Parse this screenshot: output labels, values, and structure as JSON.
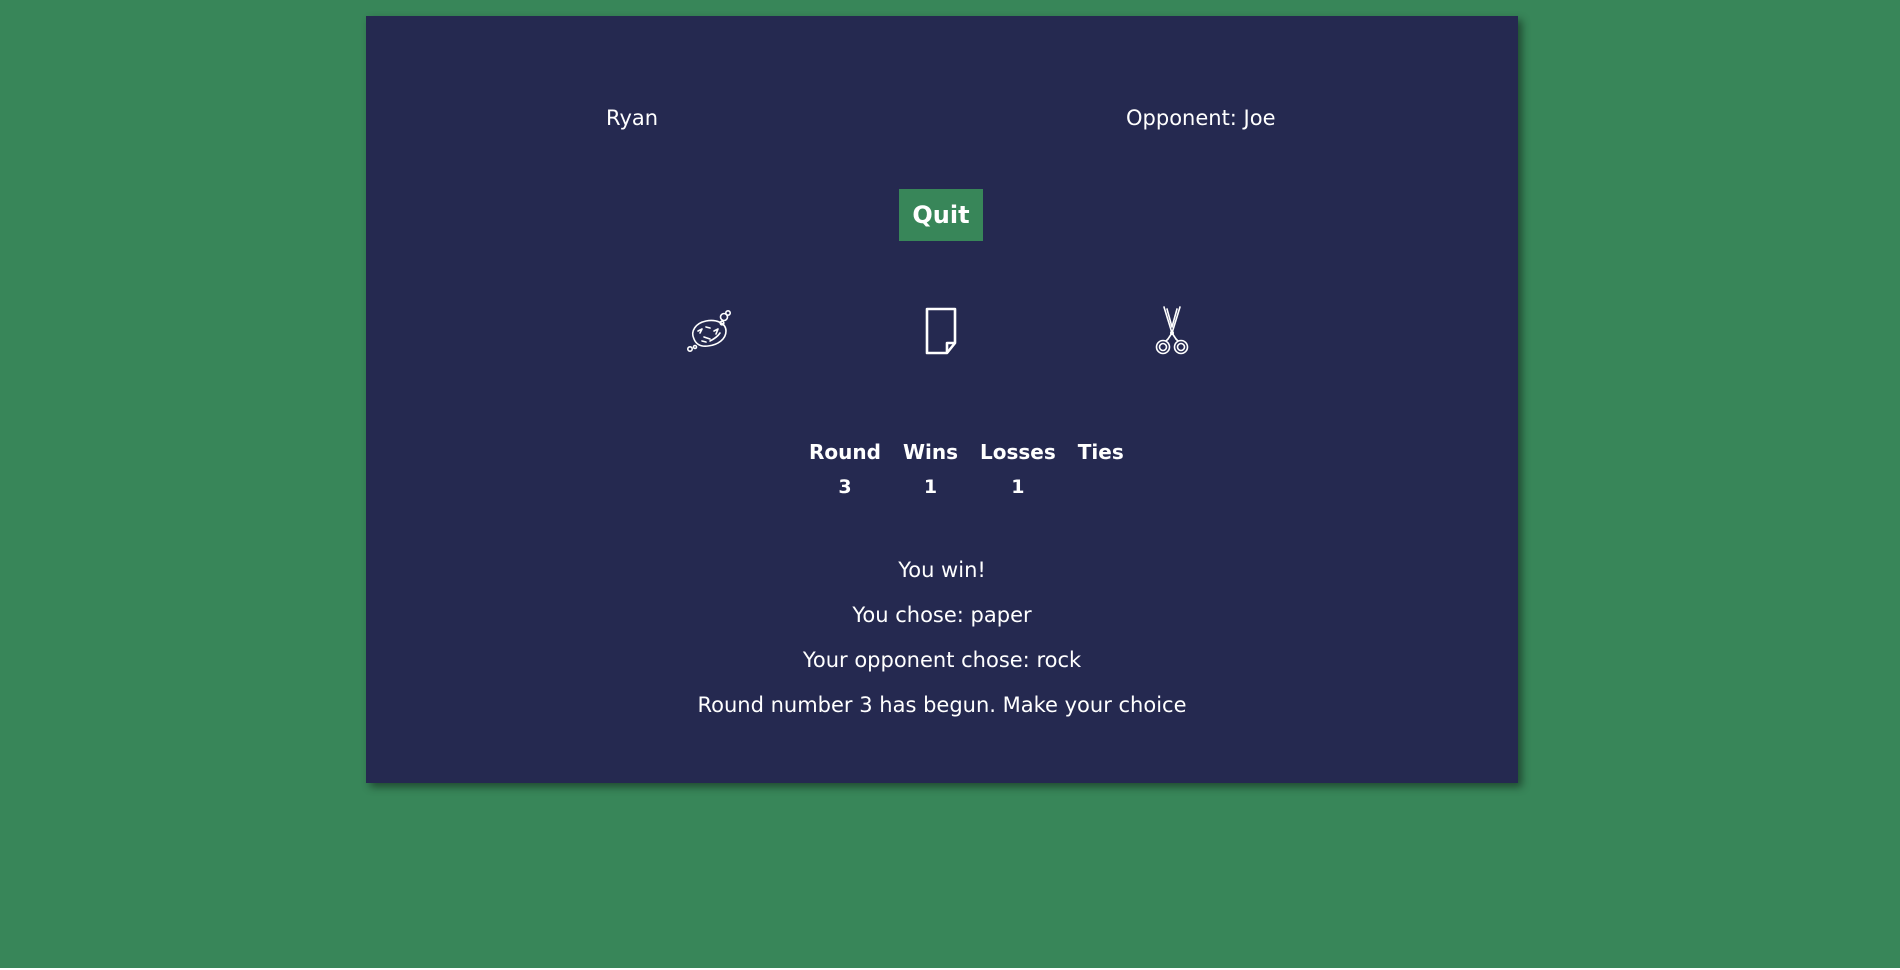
{
  "player": {
    "name": "Ryan"
  },
  "opponent": {
    "label": "Opponent: Joe"
  },
  "controls": {
    "quit_label": "Quit"
  },
  "choices": [
    {
      "name": "rock",
      "icon": "rock-icon"
    },
    {
      "name": "paper",
      "icon": "paper-icon"
    },
    {
      "name": "scissors",
      "icon": "scissors-icon"
    }
  ],
  "scoreboard": {
    "headers": [
      "Round",
      "Wins",
      "Losses",
      "Ties"
    ],
    "values": [
      "3",
      "1",
      "1",
      ""
    ]
  },
  "messages": [
    "You win!",
    "You chose: paper",
    "Your opponent chose: rock",
    "Round number 3 has begun. Make your choice"
  ],
  "colors": {
    "background": "#388659",
    "panel": "#252950",
    "accent": "#388659",
    "text": "#ffffff"
  }
}
